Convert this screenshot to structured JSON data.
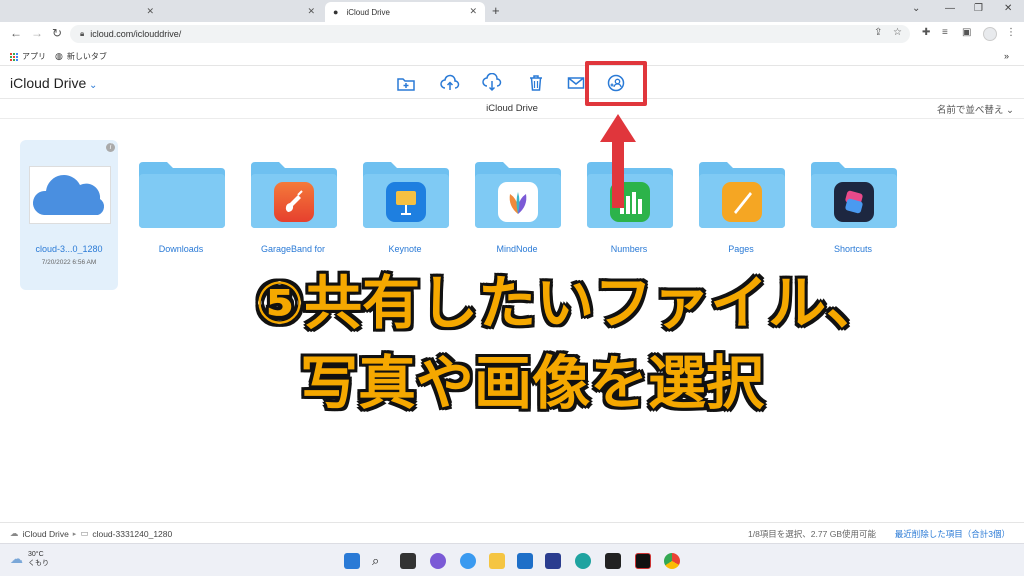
{
  "browser": {
    "active_tab_title": "iCloud Drive",
    "url": "icloud.com/iclouddrive/",
    "bookmarks": [
      {
        "label": "アプリ"
      },
      {
        "label": "新しいタブ"
      }
    ]
  },
  "icloud": {
    "brand": "iCloud Drive",
    "folder_title": "iCloud Drive",
    "sort_label": "名前で並べ替え",
    "toolbar_icons": [
      "new-folder-icon",
      "upload-icon",
      "download-icon",
      "trash-icon",
      "mail-icon",
      "share-person-icon"
    ],
    "items": [
      {
        "name": "cloud-3...0_1280",
        "date": "7/20/2022 6:56 AM",
        "kind": "image"
      },
      {
        "name": "Downloads",
        "kind": "folder"
      },
      {
        "name": "GarageBand for",
        "kind": "app-folder",
        "app": "garageband"
      },
      {
        "name": "Keynote",
        "kind": "app-folder",
        "app": "keynote"
      },
      {
        "name": "MindNode",
        "kind": "app-folder",
        "app": "mindnode"
      },
      {
        "name": "Numbers",
        "kind": "app-folder",
        "app": "numbers"
      },
      {
        "name": "Pages",
        "kind": "app-folder",
        "app": "pages"
      },
      {
        "name": "Shortcuts",
        "kind": "app-folder",
        "app": "shortcuts"
      }
    ],
    "footer": {
      "crumb_root": "iCloud Drive",
      "crumb_file": "cloud-3331240_1280",
      "status": "1/8項目を選択、2.77 GB使用可能",
      "recently_deleted": "最近削除した項目（合計3個）"
    }
  },
  "overlay": {
    "line1": "⑤共有したいファイル、",
    "line2": "写真や画像を選択"
  },
  "taskbar": {
    "temp": "30°C",
    "condition": "くもり"
  },
  "colors": {
    "accent": "#2a7ad6",
    "highlight": "#e0363c",
    "overlay_text": "#f5a800"
  }
}
